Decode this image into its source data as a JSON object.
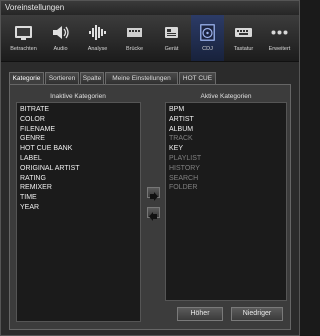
{
  "window": {
    "title": "Voreinstellungen"
  },
  "toolbar": {
    "items": [
      {
        "label": "Betrachten",
        "icon": "view-icon"
      },
      {
        "label": "Audio",
        "icon": "speaker-icon"
      },
      {
        "label": "Analyse",
        "icon": "waveform-icon"
      },
      {
        "label": "Brücke",
        "icon": "bridge-icon"
      },
      {
        "label": "Gerät",
        "icon": "device-icon"
      },
      {
        "label": "CDJ",
        "icon": "cdj-icon"
      },
      {
        "label": "Tastatur",
        "icon": "keyboard-icon"
      },
      {
        "label": "Erweitert",
        "icon": "more-icon"
      }
    ],
    "active_index": 5
  },
  "tabs": [
    {
      "label": "Kategorie"
    },
    {
      "label": "Sortieren"
    },
    {
      "label": "Spalte"
    },
    {
      "label": "Meine Einstellungen"
    },
    {
      "label": "HOT CUE"
    }
  ],
  "inactive": {
    "heading": "Inaktive Kategorien",
    "items": [
      "BITRATE",
      "COLOR",
      "FILENAME",
      "GENRE",
      "HOT CUE BANK",
      "LABEL",
      "ORIGINAL ARTIST",
      "RATING",
      "REMIXER",
      "TIME",
      "YEAR"
    ]
  },
  "active": {
    "heading": "Aktive Kategorien",
    "items": [
      {
        "label": "BPM",
        "enabled": true
      },
      {
        "label": "ARTIST",
        "enabled": true
      },
      {
        "label": "ALBUM",
        "enabled": true
      },
      {
        "label": "TRACK",
        "enabled": false
      },
      {
        "label": "KEY",
        "enabled": true
      },
      {
        "label": "PLAYLIST",
        "enabled": false
      },
      {
        "label": "HISTORY",
        "enabled": false
      },
      {
        "label": "SEARCH",
        "enabled": false
      },
      {
        "label": "FOLDER",
        "enabled": false
      }
    ]
  },
  "buttons": {
    "higher": "Höher",
    "lower": "Niedriger"
  },
  "colors": {
    "accent": "#2c3b66",
    "list_bg": "#1b1b1b",
    "dim_text": "#808080"
  }
}
